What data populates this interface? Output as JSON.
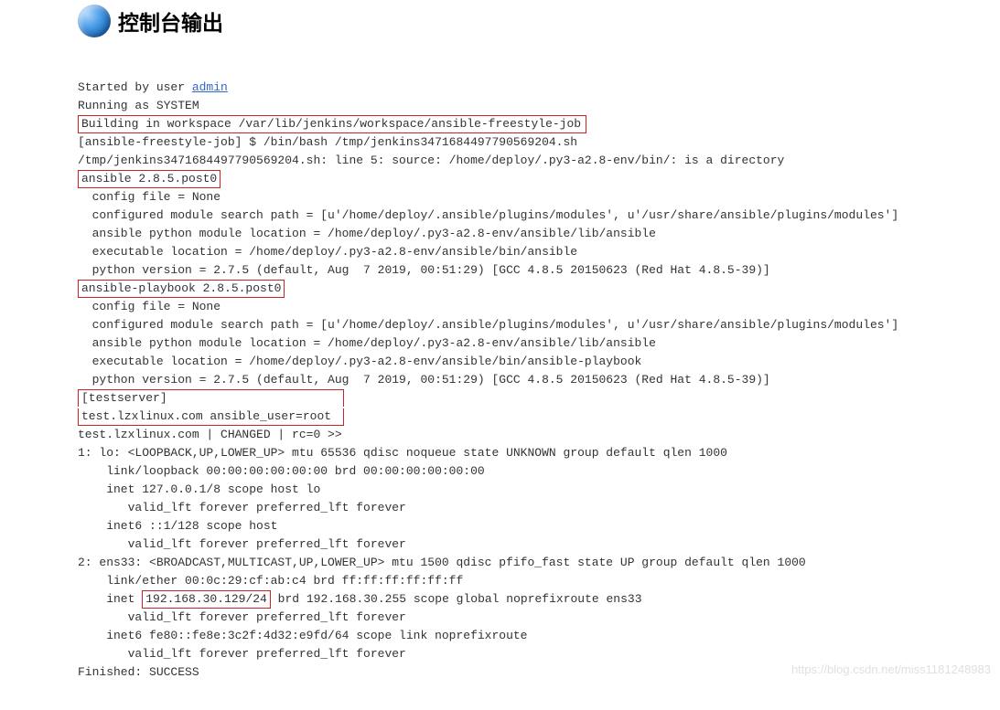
{
  "header": {
    "title": "控制台输出"
  },
  "console": {
    "line01_prefix": "Started by user ",
    "line01_user": "admin",
    "line02": "Running as SYSTEM",
    "line03_hl": "Building in workspace /var/lib/jenkins/workspace/ansible-freestyle-job",
    "line04": "[ansible-freestyle-job] $ /bin/bash /tmp/jenkins3471684497790569204.sh",
    "line05": "/tmp/jenkins3471684497790569204.sh: line 5: source: /home/deploy/.py3-a2.8-env/bin/: is a directory",
    "line06_hl": "ansible 2.8.5.post0",
    "line07": "  config file = None",
    "line08": "  configured module search path = [u'/home/deploy/.ansible/plugins/modules', u'/usr/share/ansible/plugins/modules']",
    "line09": "  ansible python module location = /home/deploy/.py3-a2.8-env/ansible/lib/ansible",
    "line10": "  executable location = /home/deploy/.py3-a2.8-env/ansible/bin/ansible",
    "line11": "  python version = 2.7.5 (default, Aug  7 2019, 00:51:29) [GCC 4.8.5 20150623 (Red Hat 4.8.5-39)]",
    "line12_hl": "ansible-playbook 2.8.5.post0",
    "line13": "  config file = None",
    "line14": "  configured module search path = [u'/home/deploy/.ansible/plugins/modules', u'/usr/share/ansible/plugins/modules']",
    "line15": "  ansible python module location = /home/deploy/.py3-a2.8-env/ansible/lib/ansible",
    "line16": "  executable location = /home/deploy/.py3-a2.8-env/ansible/bin/ansible-playbook",
    "line17": "  python version = 2.7.5 (default, Aug  7 2019, 00:51:29) [GCC 4.8.5 20150623 (Red Hat 4.8.5-39)]",
    "line18_hl_a": "[testserver]                        ",
    "line18_hl_b": "test.lzxlinux.com ansible_user=root ",
    "line19": "test.lzxlinux.com | CHANGED | rc=0 >>",
    "line20": "1: lo: <LOOPBACK,UP,LOWER_UP> mtu 65536 qdisc noqueue state UNKNOWN group default qlen 1000",
    "line21": "    link/loopback 00:00:00:00:00:00 brd 00:00:00:00:00:00",
    "line22": "    inet 127.0.0.1/8 scope host lo",
    "line23": "       valid_lft forever preferred_lft forever",
    "line24": "    inet6 ::1/128 scope host ",
    "line25": "       valid_lft forever preferred_lft forever",
    "line26": "2: ens33: <BROADCAST,MULTICAST,UP,LOWER_UP> mtu 1500 qdisc pfifo_fast state UP group default qlen 1000",
    "line27": "    link/ether 00:0c:29:cf:ab:c4 brd ff:ff:ff:ff:ff:ff",
    "line28_a": "    inet ",
    "line28_hl": "192.168.30.129/24",
    "line28_b": " brd 192.168.30.255 scope global noprefixroute ens33",
    "line29": "       valid_lft forever preferred_lft forever",
    "line30": "    inet6 fe80::fe8e:3c2f:4d32:e9fd/64 scope link noprefixroute ",
    "line31": "       valid_lft forever preferred_lft forever",
    "line32": "Finished: SUCCESS"
  },
  "watermark": "https://blog.csdn.net/miss1181248983"
}
